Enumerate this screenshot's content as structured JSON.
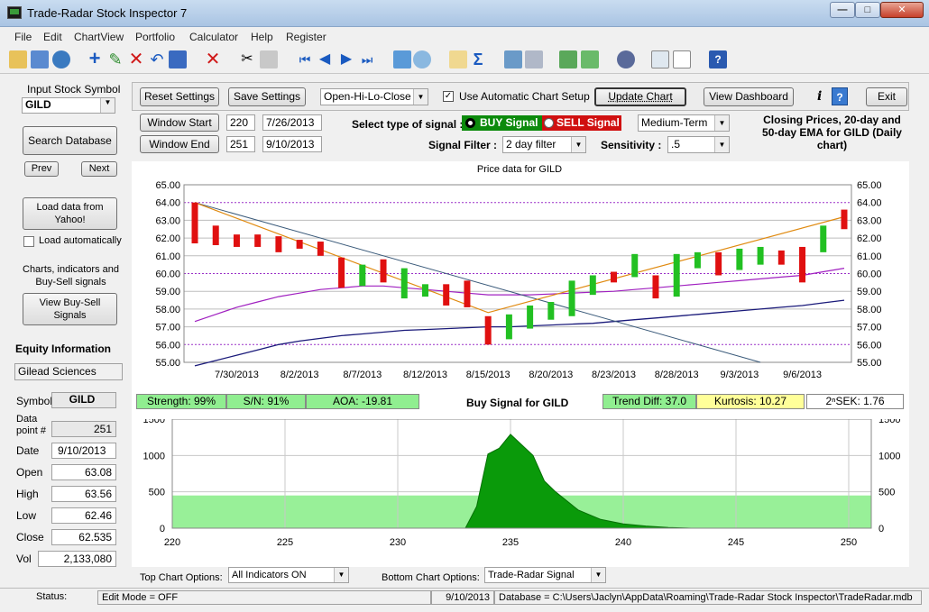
{
  "window": {
    "title": "Trade-Radar Stock Inspector 7"
  },
  "menu": [
    "File",
    "Edit",
    "ChartView",
    "Portfolio",
    "Calculator",
    "Help",
    "Register"
  ],
  "sidebar": {
    "input_label": "Input Stock Symbol",
    "symbol": "GILD",
    "search_label": "Search Database",
    "prev_label": "Prev",
    "next_label": "Next",
    "load_label": "Load data from Yahoo!",
    "auto_label": "Load automatically",
    "charts_text": "Charts, indicators and Buy-Sell signals",
    "view_signals_label": "View Buy-Sell Signals",
    "equity_heading": "Equity Information",
    "company": "Gilead Sciences",
    "info": [
      {
        "label": "Symbol",
        "value": "GILD"
      },
      {
        "label": "Data point #",
        "value": "251"
      },
      {
        "label": "Date",
        "value": "9/10/2013"
      },
      {
        "label": "Open",
        "value": "63.08"
      },
      {
        "label": "High",
        "value": "63.56"
      },
      {
        "label": "Low",
        "value": "62.46"
      },
      {
        "label": "Close",
        "value": "62.535"
      },
      {
        "label": "Vol",
        "value": "2,133,080"
      }
    ]
  },
  "controls": {
    "reset": "Reset Settings",
    "save": "Save Settings",
    "chart_type": "Open-Hi-Lo-Close",
    "auto_setup": "Use Automatic Chart Setup",
    "update": "Update Chart",
    "dashboard": "View Dashboard",
    "info_i": "i",
    "help_q": "?",
    "exit": "Exit",
    "window_start": "Window Start",
    "window_end": "Window End",
    "start_index": "220",
    "start_date": "7/26/2013",
    "end_index": "251",
    "end_date": "9/10/2013",
    "signal_type_label": "Select type of signal :",
    "buy_signal": "BUY Signal",
    "sell_signal": "SELL Signal",
    "term": "Medium-Term",
    "filter_label": "Signal Filter :",
    "filter": "2 day filter",
    "sensitivity_label": "Sensitivity :",
    "sensitivity": ".5",
    "chart_desc": "Closing Prices, 20-day and 50-day EMA for GILD (Daily chart)"
  },
  "metrics": {
    "strength": "Strength: 99%",
    "sn": "S/N: 91%",
    "aoa": "AOA: -19.81",
    "signal": "Buy Signal for GILD",
    "trend": "Trend Diff: 37.0",
    "kurtosis": "Kurtosis: 10.27",
    "sek": "2ⁿSEK: 1.76"
  },
  "bottom": {
    "top_opts_label": "Top Chart Options:",
    "top_opts": "All Indicators ON",
    "bottom_opts_label": "Bottom Chart Options:",
    "bottom_opts": "Trade-Radar Signal"
  },
  "status": {
    "label": "Status:",
    "mode": "Edit Mode = OFF",
    "date": "9/10/2013",
    "db": "Database = C:\\Users\\Jaclyn\\AppData\\Roaming\\Trade-Radar Stock Inspector\\TradeRadar.mdb"
  },
  "chart_data": [
    {
      "type": "candlestick",
      "title": "Price data for GILD",
      "ylim": [
        55,
        65
      ],
      "yticks": [
        "55.00",
        "56.00",
        "57.00",
        "58.00",
        "59.00",
        "60.00",
        "61.00",
        "62.00",
        "63.00",
        "64.00",
        "65.00"
      ],
      "xticks": [
        "7/30/2013",
        "8/2/2013",
        "8/7/2013",
        "8/12/2013",
        "8/15/2013",
        "8/20/2013",
        "8/23/2013",
        "8/28/2013",
        "9/3/2013",
        "9/6/2013"
      ],
      "xtick_index": [
        2,
        5,
        8,
        11,
        14,
        17,
        20,
        23,
        26,
        29
      ],
      "candles": [
        {
          "o": 64.0,
          "c": 61.7,
          "up": false
        },
        {
          "o": 62.7,
          "c": 61.6,
          "up": false
        },
        {
          "o": 62.2,
          "c": 61.5,
          "up": false
        },
        {
          "o": 62.2,
          "c": 61.5,
          "up": false
        },
        {
          "o": 62.1,
          "c": 61.2,
          "up": false
        },
        {
          "o": 61.9,
          "c": 61.4,
          "up": false
        },
        {
          "o": 61.8,
          "c": 61.0,
          "up": false
        },
        {
          "o": 60.9,
          "c": 59.2,
          "up": false
        },
        {
          "o": 59.3,
          "c": 60.5,
          "up": true
        },
        {
          "o": 60.8,
          "c": 59.5,
          "up": false
        },
        {
          "o": 58.6,
          "c": 60.3,
          "up": true
        },
        {
          "o": 58.7,
          "c": 59.4,
          "up": true
        },
        {
          "o": 59.4,
          "c": 58.2,
          "up": false
        },
        {
          "o": 59.6,
          "c": 58.1,
          "up": false
        },
        {
          "o": 57.6,
          "c": 56.0,
          "up": false
        },
        {
          "o": 56.3,
          "c": 57.7,
          "up": true
        },
        {
          "o": 56.9,
          "c": 58.2,
          "up": true
        },
        {
          "o": 57.4,
          "c": 58.4,
          "up": true
        },
        {
          "o": 57.6,
          "c": 59.6,
          "up": true
        },
        {
          "o": 58.8,
          "c": 59.9,
          "up": true
        },
        {
          "o": 60.1,
          "c": 59.5,
          "up": false
        },
        {
          "o": 59.8,
          "c": 61.1,
          "up": true
        },
        {
          "o": 59.9,
          "c": 58.6,
          "up": false
        },
        {
          "o": 58.7,
          "c": 61.1,
          "up": true
        },
        {
          "o": 60.3,
          "c": 61.2,
          "up": true
        },
        {
          "o": 61.2,
          "c": 59.9,
          "up": false
        },
        {
          "o": 60.2,
          "c": 61.4,
          "up": true
        },
        {
          "o": 60.5,
          "c": 61.5,
          "up": true
        },
        {
          "o": 61.3,
          "c": 60.5,
          "up": false
        },
        {
          "o": 61.5,
          "c": 59.5,
          "up": false
        },
        {
          "o": 61.2,
          "c": 62.7,
          "up": true
        },
        {
          "o": 63.6,
          "c": 62.5,
          "up": false
        }
      ],
      "ema20": [
        60.8,
        60.85,
        60.95,
        61.1,
        61.2,
        61.3,
        61.35,
        61.4,
        61.45,
        61.5,
        61.5,
        61.55,
        61.6,
        61.6,
        61.6,
        61.6,
        61.6,
        61.65,
        61.7,
        61.8,
        61.9,
        62.0,
        62.0,
        62.1,
        62.2,
        62.3,
        62.4,
        62.5,
        62.6,
        62.7,
        62.85,
        63.0
      ],
      "ema50": [
        57.3,
        57.7,
        58.1,
        58.4,
        58.7,
        58.9,
        59.1,
        59.2,
        59.3,
        59.3,
        59.2,
        59.1,
        59.0,
        58.9,
        58.8,
        58.8,
        58.8,
        58.85,
        58.9,
        58.95,
        59.0,
        59.1,
        59.2,
        59.3,
        59.4,
        59.5,
        59.6,
        59.7,
        59.8,
        59.9,
        60.1,
        60.3
      ],
      "trend_dark": [
        54.8,
        55.1,
        55.4,
        55.7,
        56.0,
        56.2,
        56.35,
        56.5,
        56.6,
        56.7,
        56.8,
        56.85,
        56.9,
        56.95,
        57.0,
        57.0,
        57.05,
        57.1,
        57.15,
        57.2,
        57.3,
        57.4,
        57.5,
        57.6,
        57.7,
        57.8,
        57.9,
        58.0,
        58.1,
        58.2,
        58.35,
        58.5
      ],
      "zigzag": [
        [
          0,
          64.0
        ],
        [
          14,
          57.8
        ],
        [
          31,
          63.2
        ]
      ],
      "downline": [
        [
          0,
          64.0
        ],
        [
          27,
          55.0
        ]
      ]
    },
    {
      "type": "area",
      "title": "Trade-Radar Signal",
      "ylim": [
        0,
        1500
      ],
      "yticks": [
        "0",
        "500",
        "1000",
        "1500"
      ],
      "xticks": [
        "220",
        "225",
        "230",
        "235",
        "240",
        "245",
        "250"
      ],
      "baseline": 450,
      "x": [
        220,
        232,
        233,
        233.5,
        234,
        234.5,
        235,
        236,
        236.5,
        237,
        238,
        239,
        240,
        241,
        242,
        243,
        251
      ],
      "values": [
        0,
        0,
        0,
        300,
        1020,
        1100,
        1290,
        1000,
        650,
        500,
        250,
        120,
        60,
        30,
        10,
        0,
        0
      ]
    }
  ]
}
